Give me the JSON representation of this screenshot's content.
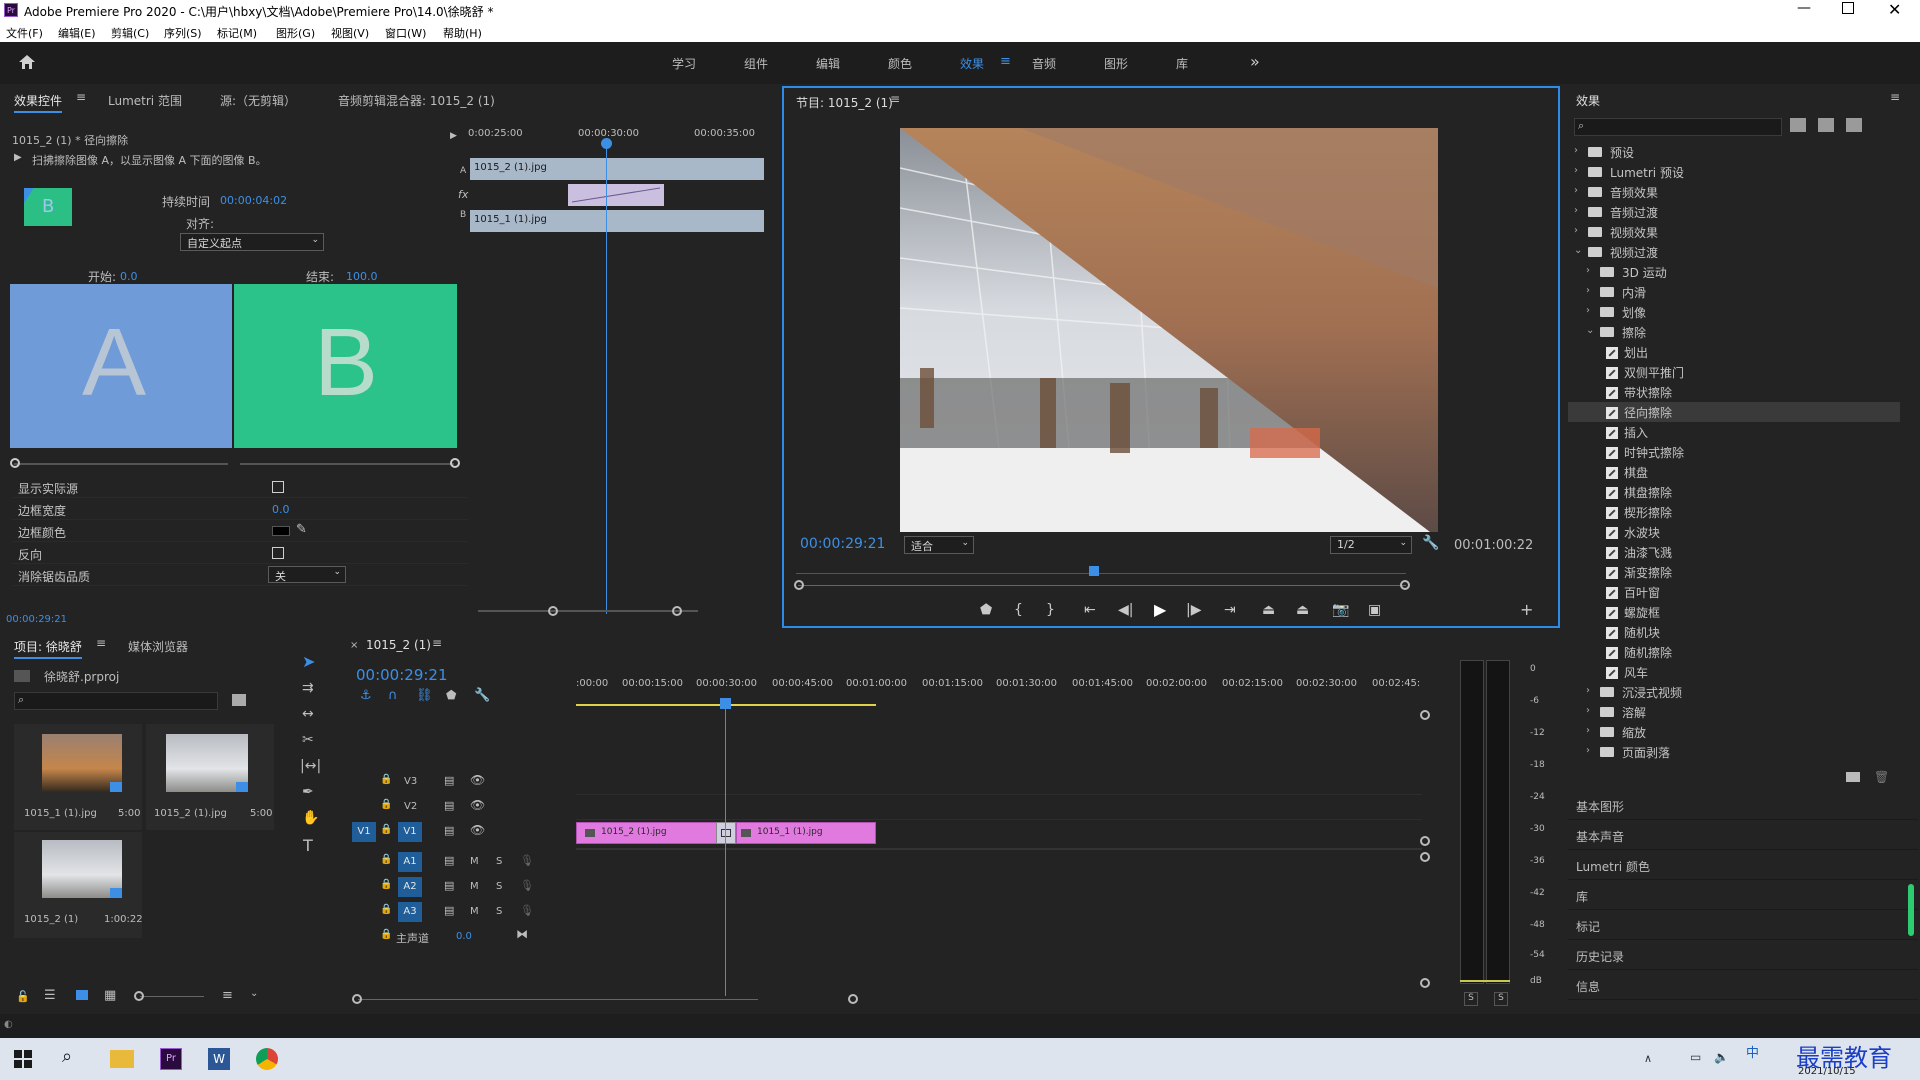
{
  "window": {
    "title": "Adobe Premiere Pro 2020 - C:\\用户\\hbxy\\文档\\Adobe\\Premiere Pro\\14.0\\徐晓舒 *",
    "app_icon": "Pr"
  },
  "menu": [
    "文件(F)",
    "编辑(E)",
    "剪辑(C)",
    "序列(S)",
    "标记(M)",
    "图形(G)",
    "视图(V)",
    "窗口(W)",
    "帮助(H)"
  ],
  "workspaces": [
    "学习",
    "组件",
    "编辑",
    "颜色",
    "效果",
    "音频",
    "图形",
    "库"
  ],
  "active_workspace": "效果",
  "effect_controls": {
    "tabs": [
      "效果控件",
      "Lumetri 范围",
      "源:（无剪辑）",
      "音频剪辑混合器: 1015_2 (1)"
    ],
    "clip_path": "1015_2 (1) * 径向擦除",
    "description": "扫拂擦除图像 A，以显示图像 A 下面的图像 B。",
    "duration_label": "持续时间",
    "duration_value": "00:00:04:02",
    "align_label": "对齐:",
    "align_value": "自定义起点",
    "start_label": "开始:",
    "start_value": "0.0",
    "end_label": "结束:",
    "end_value": "100.0",
    "letter_a": "A",
    "letter_b": "B",
    "thumb_letter": "B",
    "properties": [
      {
        "label": "显示实际源",
        "type": "checkbox"
      },
      {
        "label": "边框宽度",
        "value": "0.0"
      },
      {
        "label": "边框颜色",
        "type": "color"
      },
      {
        "label": "反向",
        "type": "checkbox"
      },
      {
        "label": "消除锯齿品质",
        "value": "关"
      }
    ],
    "timecode": "00:00:29:21",
    "ruler": [
      "0:00:25:00",
      "00:00:30:00",
      "00:00:35:00"
    ],
    "clip_a": "1015_2 (1).jpg",
    "clip_b": "1015_1 (1).jpg",
    "track_a": "A",
    "track_b": "B",
    "fx": "fx"
  },
  "program": {
    "title": "节目: 1015_2 (1)",
    "timecode": "00:00:29:21",
    "fit": "适合",
    "resolution": "1/2",
    "duration": "00:01:00:22"
  },
  "effects_panel": {
    "title": "效果",
    "tree": [
      {
        "label": "预设",
        "level": 0,
        "kind": "folder",
        "open": false
      },
      {
        "label": "Lumetri 预设",
        "level": 0,
        "kind": "folder",
        "open": false
      },
      {
        "label": "音频效果",
        "level": 0,
        "kind": "folder",
        "open": false
      },
      {
        "label": "音频过渡",
        "level": 0,
        "kind": "folder",
        "open": false
      },
      {
        "label": "视频效果",
        "level": 0,
        "kind": "folder",
        "open": false
      },
      {
        "label": "视频过渡",
        "level": 0,
        "kind": "folder",
        "open": true
      },
      {
        "label": "3D 运动",
        "level": 1,
        "kind": "folder",
        "open": false
      },
      {
        "label": "内滑",
        "level": 1,
        "kind": "folder",
        "open": false
      },
      {
        "label": "划像",
        "level": 1,
        "kind": "folder",
        "open": false
      },
      {
        "label": "擦除",
        "level": 1,
        "kind": "folder",
        "open": true
      },
      {
        "label": "划出",
        "level": 2,
        "kind": "fx"
      },
      {
        "label": "双侧平推门",
        "level": 2,
        "kind": "fx"
      },
      {
        "label": "带状擦除",
        "level": 2,
        "kind": "fx"
      },
      {
        "label": "径向擦除",
        "level": 2,
        "kind": "fx",
        "selected": true
      },
      {
        "label": "插入",
        "level": 2,
        "kind": "fx"
      },
      {
        "label": "时钟式擦除",
        "level": 2,
        "kind": "fx"
      },
      {
        "label": "棋盘",
        "level": 2,
        "kind": "fx"
      },
      {
        "label": "棋盘擦除",
        "level": 2,
        "kind": "fx"
      },
      {
        "label": "楔形擦除",
        "level": 2,
        "kind": "fx"
      },
      {
        "label": "水波块",
        "level": 2,
        "kind": "fx"
      },
      {
        "label": "油漆飞溅",
        "level": 2,
        "kind": "fx"
      },
      {
        "label": "渐变擦除",
        "level": 2,
        "kind": "fx"
      },
      {
        "label": "百叶窗",
        "level": 2,
        "kind": "fx"
      },
      {
        "label": "螺旋框",
        "level": 2,
        "kind": "fx"
      },
      {
        "label": "随机块",
        "level": 2,
        "kind": "fx"
      },
      {
        "label": "随机擦除",
        "level": 2,
        "kind": "fx"
      },
      {
        "label": "风车",
        "level": 2,
        "kind": "fx"
      },
      {
        "label": "沉浸式视频",
        "level": 1,
        "kind": "folder",
        "open": false
      },
      {
        "label": "溶解",
        "level": 1,
        "kind": "folder",
        "open": false
      },
      {
        "label": "缩放",
        "level": 1,
        "kind": "folder",
        "open": false
      },
      {
        "label": "页面剥落",
        "level": 1,
        "kind": "folder",
        "open": false
      }
    ],
    "sections": [
      "基本图形",
      "基本声音",
      "Lumetri 颜色",
      "库",
      "标记",
      "历史记录",
      "信息"
    ]
  },
  "project": {
    "tabs": [
      "项目: 徐晓舒",
      "媒体浏览器"
    ],
    "file": "徐晓舒.prproj",
    "items": [
      {
        "name": "1015_1 (1).jpg",
        "duration": "5:00"
      },
      {
        "name": "1015_2 (1).jpg",
        "duration": "5:00"
      },
      {
        "name": "1015_2 (1)",
        "duration": "1:00:22"
      }
    ]
  },
  "timeline": {
    "tab": "1015_2 (1)",
    "timecode": "00:00:29:21",
    "ruler": [
      ":00:00",
      "00:00:15:00",
      "00:00:30:00",
      "00:00:45:00",
      "00:01:00:00",
      "00:01:15:00",
      "00:01:30:00",
      "00:01:45:00",
      "00:02:00:00",
      "00:02:15:00",
      "00:02:30:00",
      "00:02:45:"
    ],
    "video_tracks": [
      "V3",
      "V2",
      "V1"
    ],
    "audio_tracks": [
      "A1",
      "A2",
      "A3"
    ],
    "source_patch": "V1",
    "master_label": "主声道",
    "master_value": "0.0",
    "clip1": "1015_2 (1).jpg",
    "clip2": "1015_1 (1).jpg",
    "mute": "M",
    "solo": "S"
  },
  "audio_meter": {
    "scale": [
      "0",
      "-6",
      "-12",
      "-18",
      "-24",
      "-30",
      "-36",
      "-42",
      "-48",
      "-54",
      "dB"
    ],
    "solo": [
      "S",
      "S"
    ]
  },
  "taskbar": {
    "date": "2021/10/15",
    "watermark": "最需教育",
    "ime": "中"
  }
}
